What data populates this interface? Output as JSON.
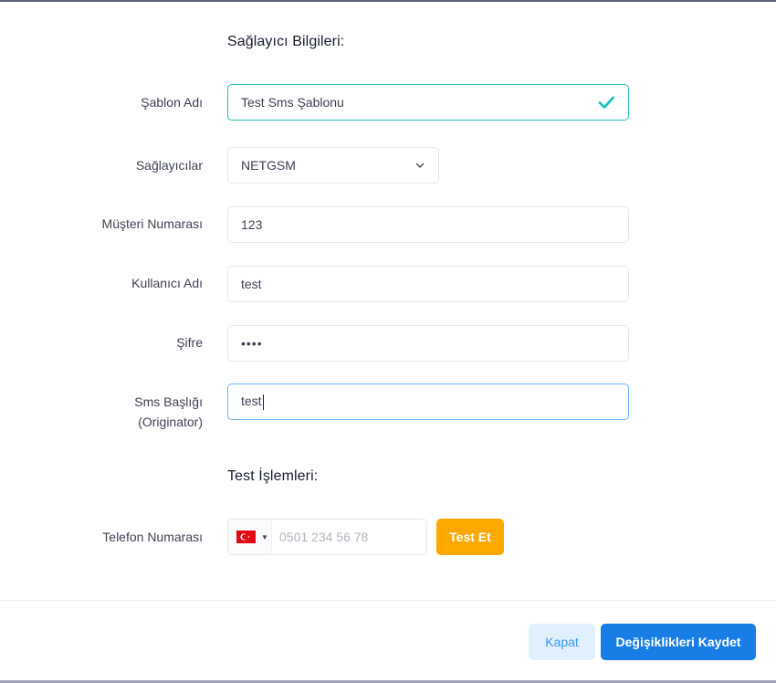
{
  "sections": {
    "provider_title": "Sağlayıcı Bilgileri:",
    "test_title": "Test İşlemleri:"
  },
  "form": {
    "template_name": {
      "label": "Şablon Adı",
      "value": "Test Sms Şablonu"
    },
    "providers": {
      "label": "Sağlayıcılar",
      "value": "NETGSM"
    },
    "customer_number": {
      "label": "Müşteri Numarası",
      "value": "123"
    },
    "username": {
      "label": "Kullanıcı Adı",
      "value": "test"
    },
    "password": {
      "label": "Şifre",
      "value": "••••"
    },
    "sms_header": {
      "label_line1": "Sms Başlığı",
      "label_line2": "(Originator)",
      "value": "test"
    },
    "phone": {
      "label": "Telefon Numarası",
      "placeholder": "0501 234 56 78",
      "country_flag": "turkey-flag-icon"
    }
  },
  "buttons": {
    "test": "Test Et",
    "close": "Kapat",
    "save": "Değişiklikleri Kaydet"
  },
  "colors": {
    "valid_border": "#1bc5bd",
    "focus_border": "#69b3ff",
    "warning": "#ffa800",
    "primary": "#187de4",
    "light_primary": "#e1f0ff"
  }
}
